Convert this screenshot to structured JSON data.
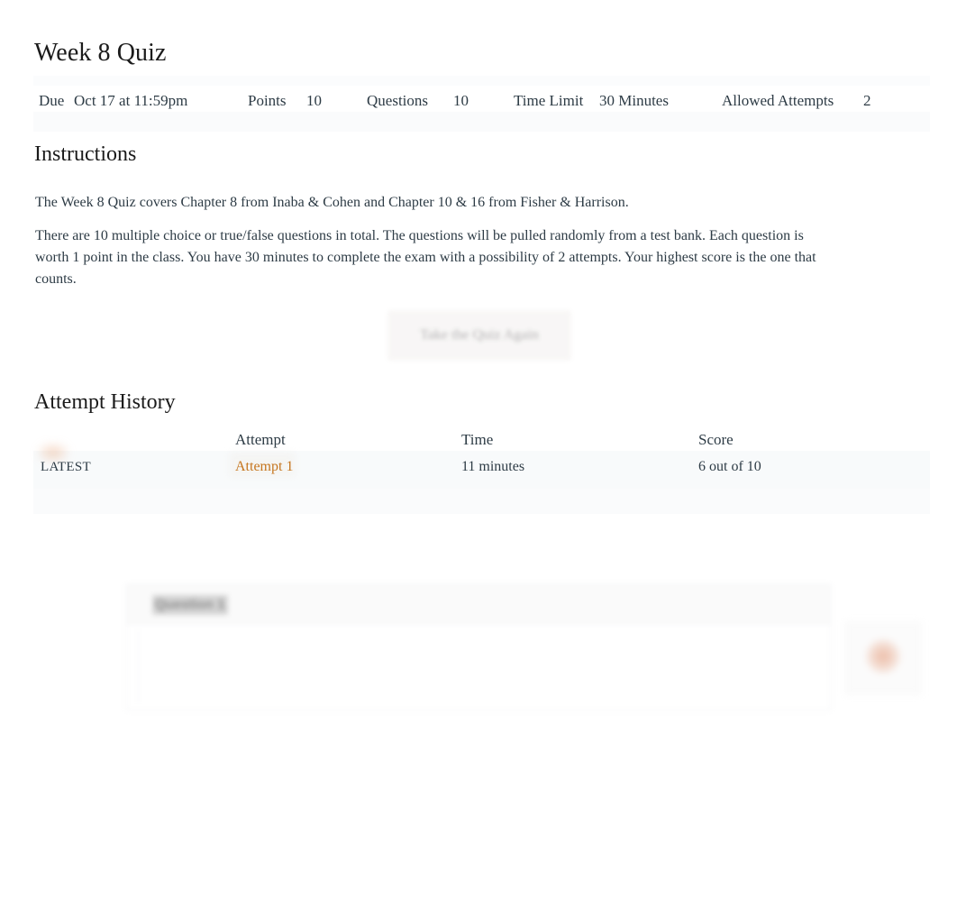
{
  "quiz": {
    "title": "Week 8 Quiz",
    "details": [
      {
        "label": "Due",
        "value": "Oct 17 at 11:59pm"
      },
      {
        "label": "Points",
        "value": "10"
      },
      {
        "label": "Questions",
        "value": "10"
      },
      {
        "label": "Time Limit",
        "value": "30 Minutes"
      },
      {
        "label": "Allowed Attempts",
        "value": "2"
      }
    ]
  },
  "instructions": {
    "heading": "Instructions",
    "paragraph_1": "The Week 8 Quiz covers Chapter 8 from Inaba & Cohen and Chapter 10 & 16 from Fisher & Harrison.",
    "paragraph_2": "There are 10 multiple choice or true/false questions in total. The questions will be pulled randomly from a test bank. Each question is worth 1 point in the class. You have 30 minutes to complete the exam with a possibility of 2 attempts. Your highest score is the one that counts."
  },
  "actions": {
    "retake_label": "Take the Quiz Again"
  },
  "attempt_history": {
    "heading": "Attempt History",
    "columns": [
      "",
      "Attempt",
      "Time",
      "Score"
    ],
    "rows": [
      {
        "kept": "LATEST",
        "attempt": "Attempt 1",
        "time": "11 minutes",
        "score": "6 out of 10"
      }
    ]
  },
  "question_card": {
    "title": "Question 1"
  },
  "colors": {
    "link": "#c5751e",
    "text": "#2d3b45",
    "heading": "#1b1b1b",
    "row_band": "#f8fafb",
    "page_background": "#ffffff"
  }
}
